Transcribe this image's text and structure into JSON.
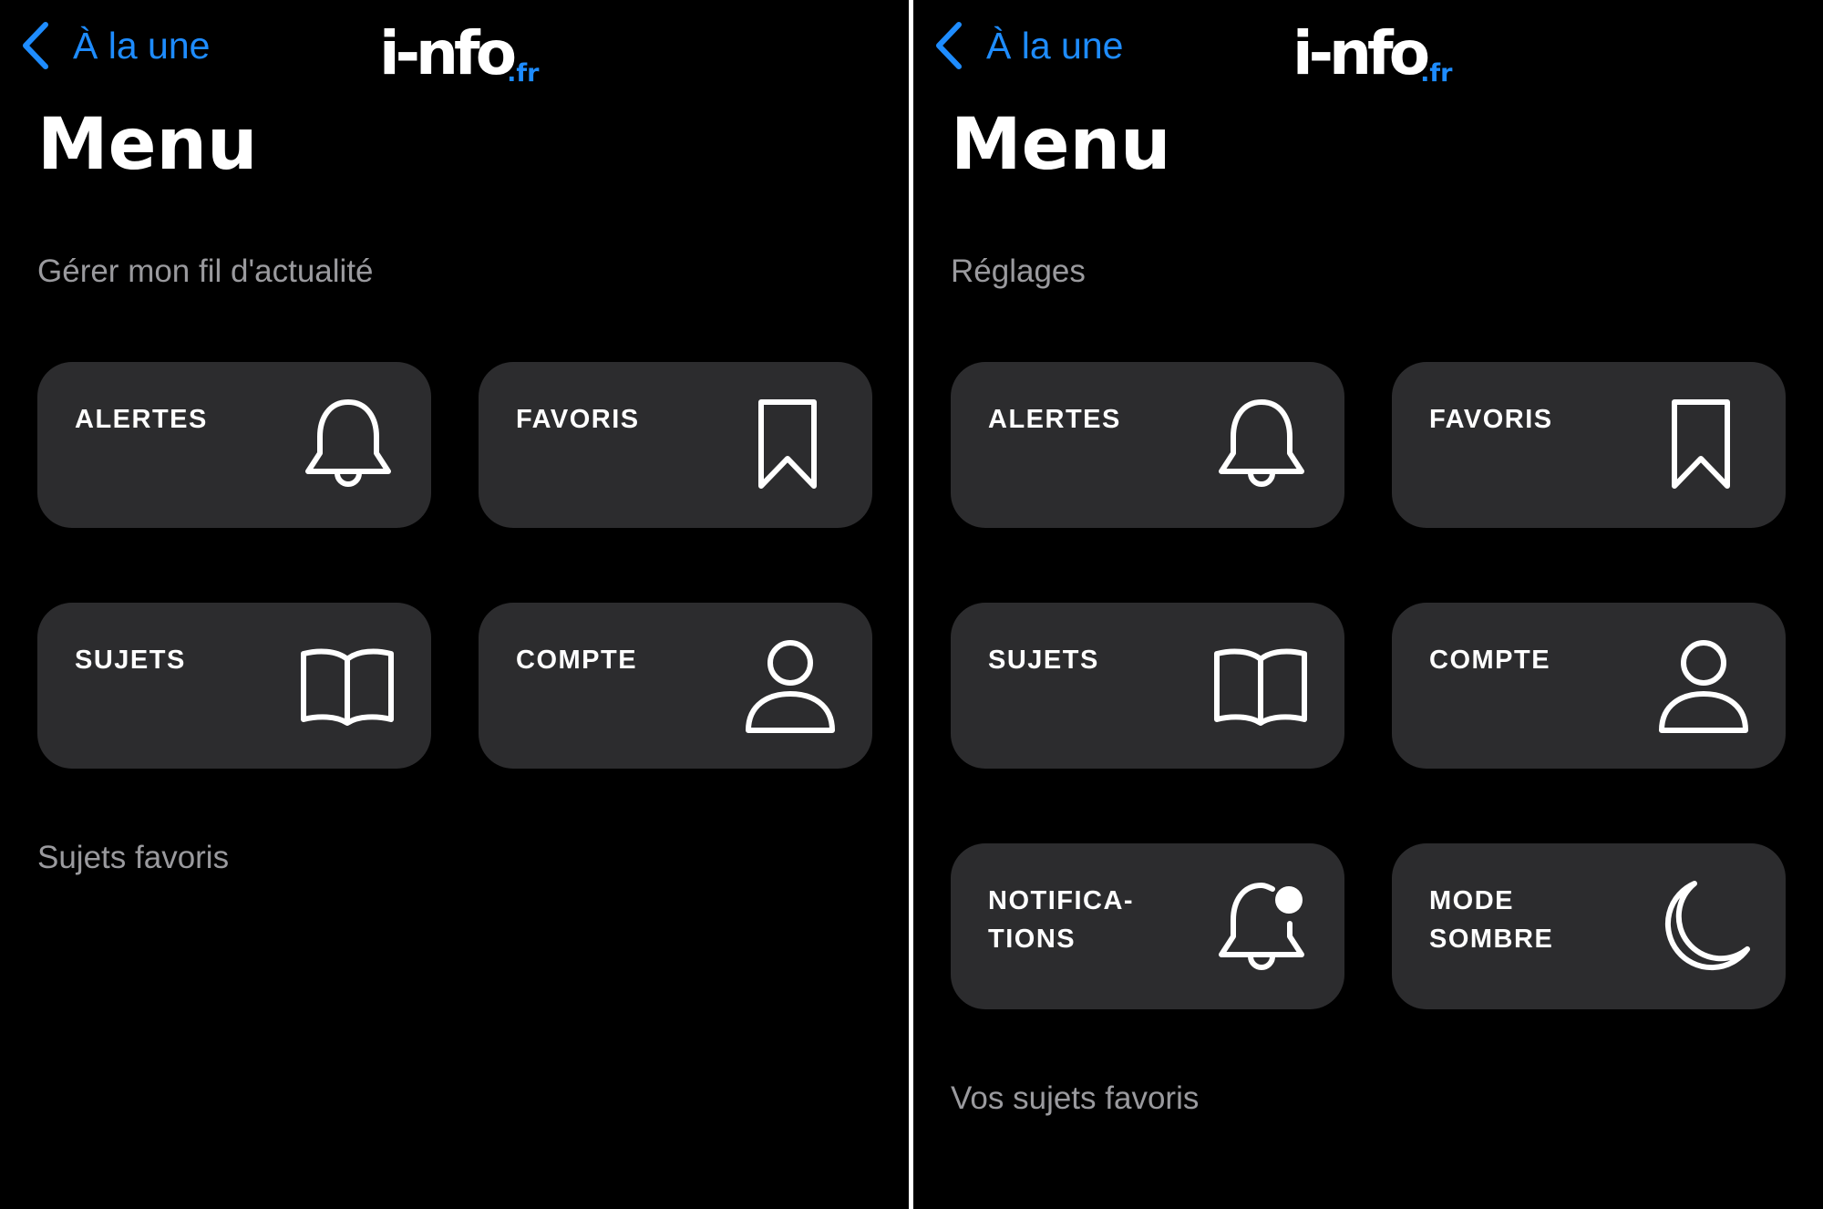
{
  "header": {
    "back_label": "À la une",
    "logo_main": "i-nfo",
    "logo_tld": ".fr"
  },
  "colors": {
    "accent": "#1e8cff",
    "background": "#000000",
    "tile": "#2c2c2e",
    "section_text": "#9a9a9e"
  },
  "left_screen": {
    "title": "Menu",
    "section_top": "Gérer mon fil d'actualité",
    "tiles": [
      {
        "label": "ALERTES",
        "icon": "bell-icon"
      },
      {
        "label": "FAVORIS",
        "icon": "bookmark-icon"
      },
      {
        "label": "SUJETS",
        "icon": "book-icon"
      },
      {
        "label": "COMPTE",
        "icon": "user-icon"
      }
    ],
    "section_bottom": "Sujets favoris"
  },
  "right_screen": {
    "title": "Menu",
    "section_top": "Réglages",
    "tiles": [
      {
        "label": "ALERTES",
        "icon": "bell-icon"
      },
      {
        "label": "FAVORIS",
        "icon": "bookmark-icon"
      },
      {
        "label": "SUJETS",
        "icon": "book-icon"
      },
      {
        "label": "COMPTE",
        "icon": "user-icon"
      },
      {
        "label": "NOTIFICA-\nTIONS",
        "icon": "notification-bell-icon"
      },
      {
        "label": "MODE\nSOMBRE",
        "icon": "moon-icon"
      }
    ],
    "section_bottom": "Vos sujets favoris"
  }
}
